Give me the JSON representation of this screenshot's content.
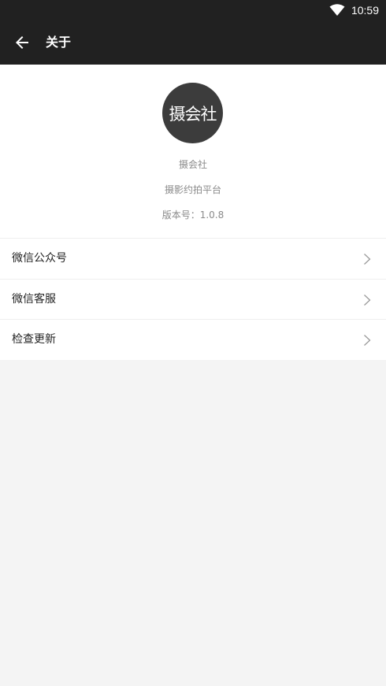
{
  "status_bar": {
    "time": "10:59"
  },
  "toolbar": {
    "title": "关于"
  },
  "about": {
    "logo_text": "摄会社",
    "app_name": "摄会社",
    "slogan": "摄影约拍平台",
    "version": "版本号：1.0.8"
  },
  "menu": {
    "items": [
      {
        "label": "微信公众号"
      },
      {
        "label": "微信客服"
      },
      {
        "label": "检查更新"
      }
    ]
  },
  "colors": {
    "toolbar_bg": "#212121",
    "page_bg": "#f4f4f4",
    "logo_bg": "#3c3c3c"
  }
}
